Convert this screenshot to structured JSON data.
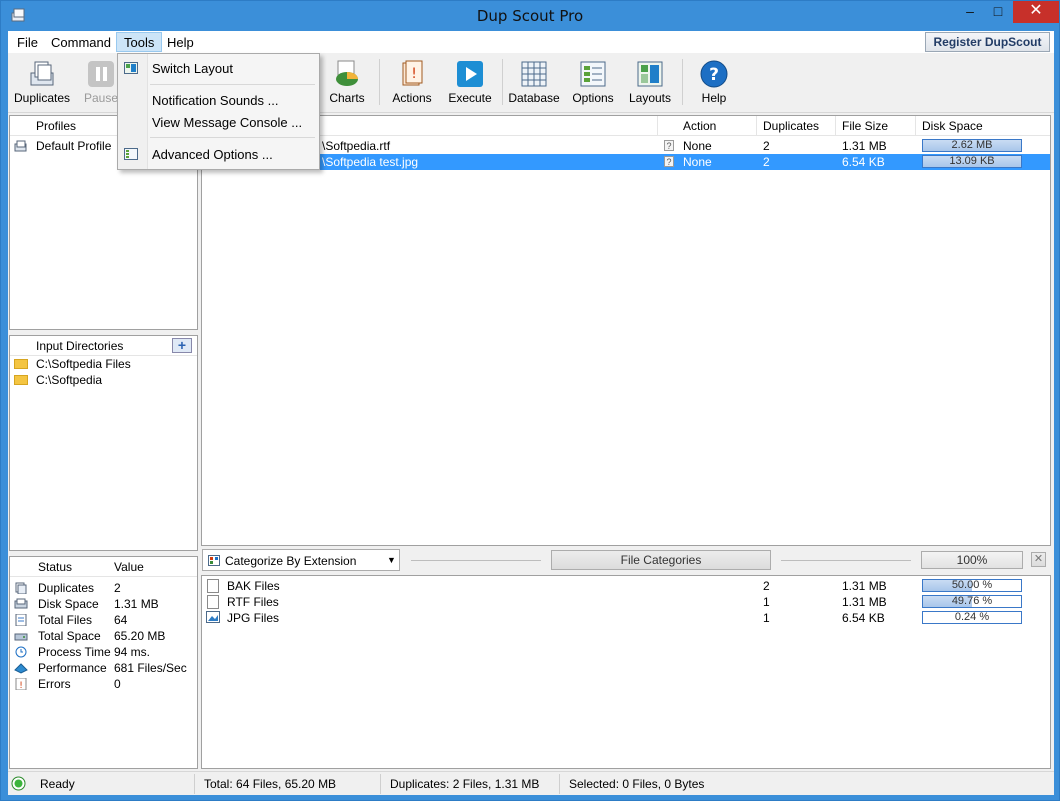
{
  "window": {
    "title": "Dup Scout Pro",
    "minimize": "–",
    "maximize": "□",
    "close": "✕"
  },
  "menu": {
    "file": "File",
    "command": "Command",
    "tools": "Tools",
    "help": "Help",
    "register": "Register DupScout"
  },
  "toolbar": {
    "duplicates": "Duplicates",
    "pause": "Pause",
    "charts": "Charts",
    "actions": "Actions",
    "execute": "Execute",
    "database": "Database",
    "options": "Options",
    "layouts": "Layouts",
    "help": "Help"
  },
  "tools_menu": {
    "switch_layout": "Switch Layout",
    "notification_sounds": "Notification Sounds ...",
    "view_console": "View Message Console ...",
    "advanced_options": "Advanced Options ..."
  },
  "profiles": {
    "header": "Profiles",
    "items": [
      "Default Profile"
    ]
  },
  "input_dirs": {
    "header": "Input Directories",
    "add": "+",
    "items": [
      "C:\\Softpedia Files",
      "C:\\Softpedia"
    ]
  },
  "stats": {
    "header_status": "Status",
    "header_value": "Value",
    "rows": [
      {
        "name": "Duplicates",
        "value": "2"
      },
      {
        "name": "Disk Space",
        "value": "1.31 MB"
      },
      {
        "name": "Total Files",
        "value": "64"
      },
      {
        "name": "Total Space",
        "value": "65.20 MB"
      },
      {
        "name": "Process Time",
        "value": "94 ms."
      },
      {
        "name": "Performance",
        "value": "681 Files/Sec"
      },
      {
        "name": "Errors",
        "value": "0"
      }
    ]
  },
  "results": {
    "headers": {
      "action": "Action",
      "duplicates": "Duplicates",
      "file_size": "File Size",
      "disk_space": "Disk Space"
    },
    "rows": [
      {
        "name": "\\Softpedia.rtf",
        "action": "None",
        "duplicates": "2",
        "file_size": "1.31 MB",
        "disk_space": "2.62 MB",
        "fill": 1.0
      },
      {
        "name": "\\Softpedia test.jpg",
        "action": "None",
        "duplicates": "2",
        "file_size": "6.54 KB",
        "disk_space": "13.09 KB",
        "fill": 1.0
      }
    ]
  },
  "categories": {
    "combo": "Categorize By Extension",
    "title_button": "File Categories",
    "percent": "100%",
    "close": "✕",
    "rows": [
      {
        "name": "BAK Files",
        "count": "2",
        "size": "1.31 MB",
        "pct": "50.00 %",
        "fill": 0.5
      },
      {
        "name": "RTF Files",
        "count": "1",
        "size": "1.31 MB",
        "pct": "49.76 %",
        "fill": 0.4976
      },
      {
        "name": "JPG Files",
        "count": "1",
        "size": "6.54 KB",
        "pct": "0.24 %",
        "fill": 0.0024
      }
    ]
  },
  "status": {
    "ready": "Ready",
    "total": "Total: 64 Files, 65.20 MB",
    "duplicates": "Duplicates: 2 Files, 1.31 MB",
    "selected": "Selected: 0 Files, 0 Bytes"
  }
}
